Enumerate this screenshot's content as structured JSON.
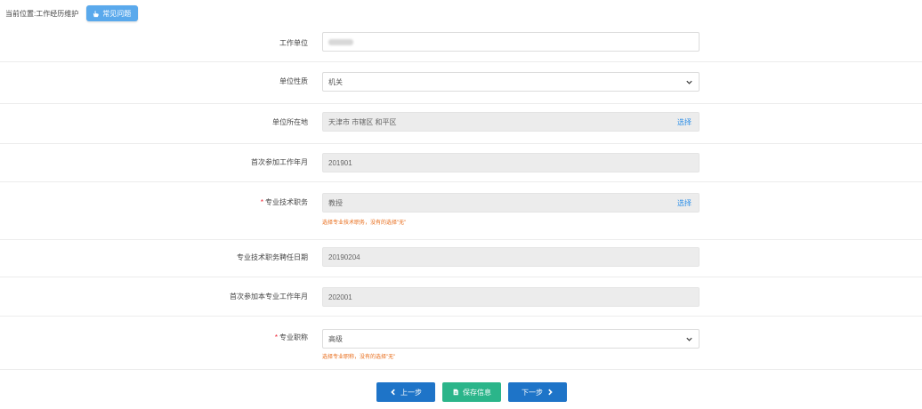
{
  "breadcrumb": {
    "prefix": "当前位置:",
    "current": "工作经历维护",
    "faq_label": "常见问题"
  },
  "form": {
    "rows": [
      {
        "label": "工作单位",
        "value": "",
        "required": false,
        "type": "text",
        "blurred": true
      },
      {
        "label": "单位性质",
        "value": "机关",
        "required": false,
        "type": "select"
      },
      {
        "label": "单位所在地",
        "value": "天津市 市辖区 和平区",
        "required": false,
        "type": "picker",
        "action": "选择"
      },
      {
        "label": "首次参加工作年月",
        "value": "201901",
        "required": false,
        "type": "readonly"
      },
      {
        "label": "专业技术职务",
        "value": "教授",
        "required": true,
        "type": "picker",
        "action": "选择",
        "hint": "选择专业技术职务，没有的选择\"无\""
      },
      {
        "label": "专业技术职务聘任日期",
        "value": "20190204",
        "required": false,
        "type": "readonly"
      },
      {
        "label": "首次参加本专业工作年月",
        "value": "202001",
        "required": false,
        "type": "readonly"
      },
      {
        "label": "专业职称",
        "value": "高级",
        "required": true,
        "type": "select",
        "hint": "选择专业职称，没有的选择\"无\""
      }
    ]
  },
  "buttons": {
    "prev_label": "上一步",
    "save_label": "保存信息",
    "next_label": "下一步"
  },
  "colors": {
    "primary": "#1e74c8",
    "save": "#2bb58a",
    "faq": "#5aa9ec",
    "hint": "#e86c1a",
    "required": "#e22233",
    "link": "#2b8ee8"
  }
}
